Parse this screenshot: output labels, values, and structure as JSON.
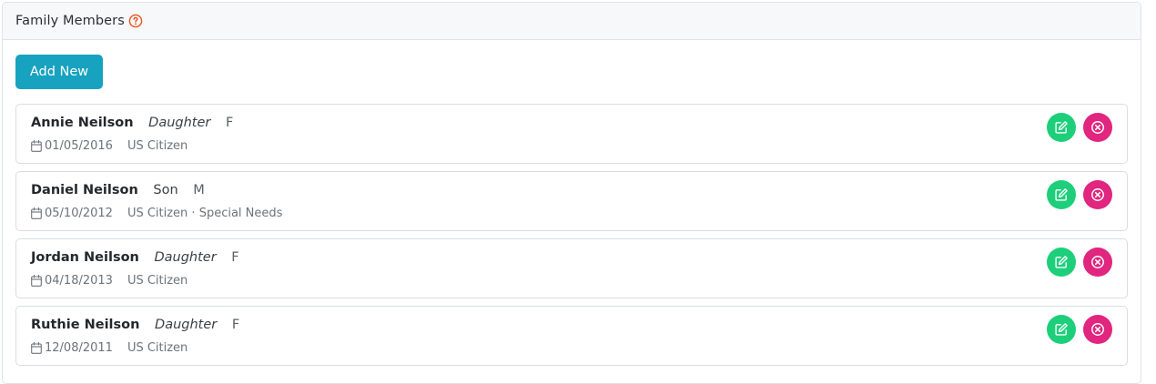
{
  "panel": {
    "title": "Family Members",
    "help_icon": "question-circle-icon",
    "accent_color": "#e8531e"
  },
  "toolbar": {
    "add_label": "Add New",
    "add_color": "#17a2c0"
  },
  "members": [
    {
      "name": "Annie Neilson",
      "relation": "Daughter",
      "relation_italic": true,
      "gender": "F",
      "dob": "01/05/2016",
      "status": "US Citizen"
    },
    {
      "name": "Daniel Neilson",
      "relation": "Son",
      "relation_italic": false,
      "gender": "M",
      "dob": "05/10/2012",
      "status": "US Citizen · Special Needs"
    },
    {
      "name": "Jordan Neilson",
      "relation": "Daughter",
      "relation_italic": true,
      "gender": "F",
      "dob": "04/18/2013",
      "status": "US Citizen"
    },
    {
      "name": "Ruthie Neilson",
      "relation": "Daughter",
      "relation_italic": true,
      "gender": "F",
      "dob": "12/08/2011",
      "status": "US Citizen"
    }
  ],
  "actions": {
    "edit_icon": "edit-icon",
    "edit_color": "#1dcf7b",
    "delete_icon": "close-circle-icon",
    "delete_color": "#e0267e"
  }
}
